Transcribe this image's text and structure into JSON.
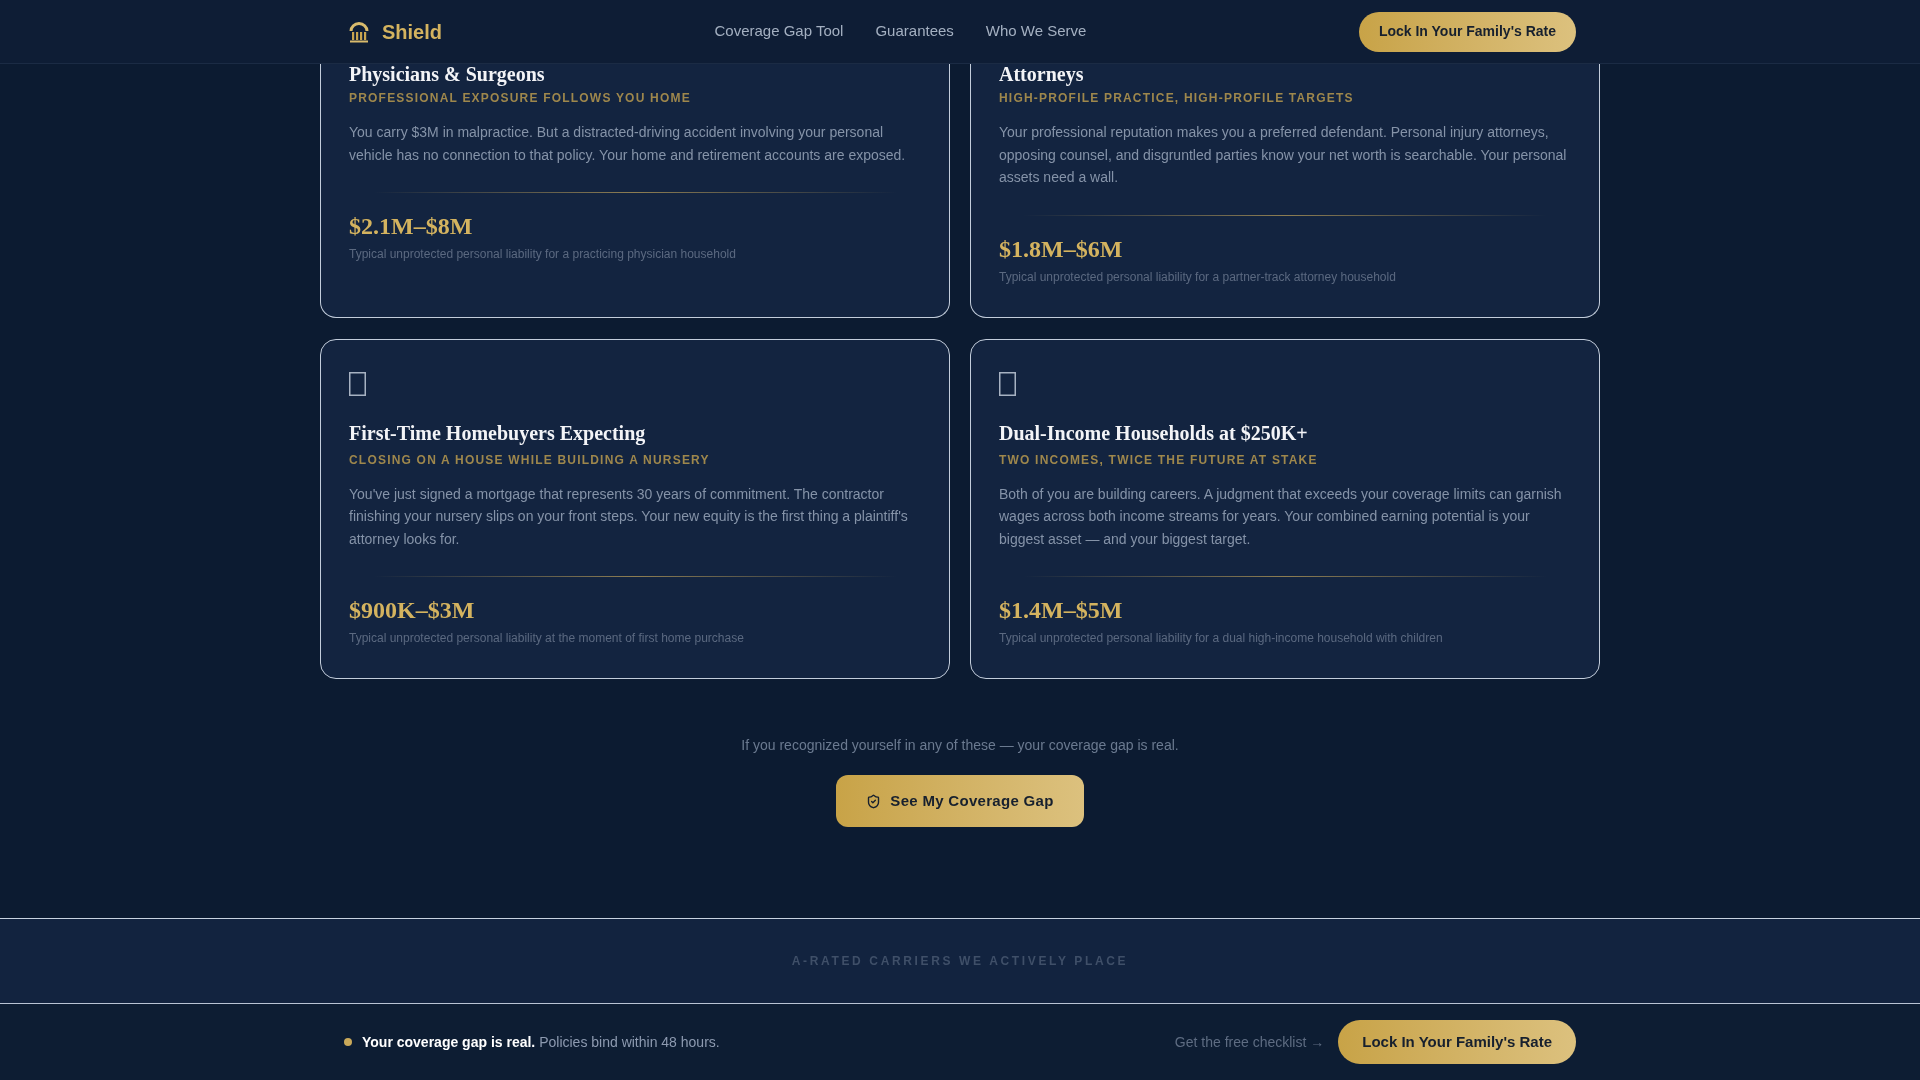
{
  "header": {
    "brand": "Shield",
    "nav": [
      "Coverage Gap Tool",
      "Guarantees",
      "Who We Serve"
    ],
    "cta": "Lock In Your Family's Rate"
  },
  "segments": [
    {
      "kind": "clipped",
      "title": "Physicians & Surgeons",
      "tagline": "PROFESSIONAL EXPOSURE FOLLOWS YOU HOME",
      "description": "You carry $3M in malpractice. But a distracted-driving accident involving your personal vehicle has no connection to that policy. Your home and retirement accounts are exposed.",
      "amount": "$2.1M–$8M",
      "caption": "Typical unprotected personal liability for a practicing physician household"
    },
    {
      "kind": "clipped",
      "title": "Attorneys",
      "tagline": "HIGH-PROFILE PRACTICE, HIGH-PROFILE TARGETS",
      "description": "Your professional reputation makes you a preferred defendant. Personal injury attorneys, opposing counsel, and disgruntled parties know your net worth is searchable. Your personal assets need a wall.",
      "amount": "$1.8M–$6M",
      "caption": "Typical unprotected personal liability for a partner-track attorney household"
    },
    {
      "kind": "whole",
      "title": "First-Time Homebuyers Expecting",
      "tagline": "CLOSING ON A HOUSE WHILE BUILDING A NURSERY",
      "description": "You've just signed a mortgage that represents 30 years of commitment. The contractor finishing your nursery slips on your front steps. Your new equity is the first thing a plaintiff's attorney looks for.",
      "amount": "$900K–$3M",
      "caption": "Typical unprotected personal liability at the moment of first home purchase"
    },
    {
      "kind": "whole",
      "title": "Dual-Income Households at $250K+",
      "tagline": "TWO INCOMES, TWICE THE FUTURE AT STAKE",
      "description": "Both of you are building careers. A judgment that exceeds your coverage limits can garnish wages across both income streams for years. Your combined earning potential is your biggest asset — and your biggest target.",
      "amount": "$1.4M–$5M",
      "caption": "Typical unprotected personal liability for a dual high-income household with children"
    }
  ],
  "prompt": {
    "text": "If you recognized yourself in any of these — your coverage gap is real.",
    "button": "See My Coverage Gap"
  },
  "carriers": {
    "heading": "A-RATED CARRIERS WE ACTIVELY PLACE"
  },
  "sticky_bar": {
    "message": "**Your coverage gap is real.** Policies bind within 48 hours.",
    "link": "Get the free checklist →",
    "button": "Lock In Your Family's Rate"
  }
}
